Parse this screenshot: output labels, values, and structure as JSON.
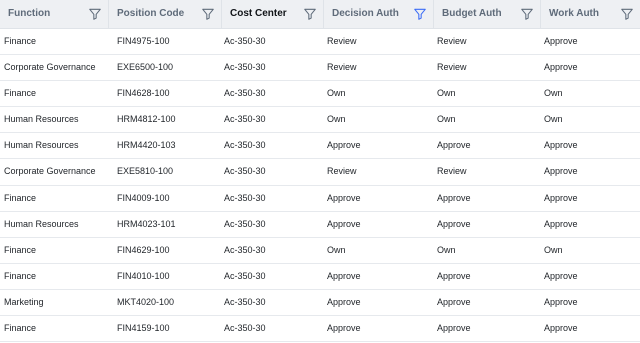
{
  "columns": [
    {
      "label": "Function",
      "filter_color": "#5f6b7a"
    },
    {
      "label": "Position Code",
      "filter_color": "#5f6b7a"
    },
    {
      "label": "Cost Center",
      "filter_color": "#5f6b7a"
    },
    {
      "label": "Decision Auth",
      "filter_color": "#3b6cf6"
    },
    {
      "label": "Budget Auth",
      "filter_color": "#5f6b7a"
    },
    {
      "label": "Work Auth",
      "filter_color": "#5f6b7a"
    }
  ],
  "rows": [
    [
      "Finance",
      "FIN4975-100",
      "Ac-350-30",
      "Review",
      "Review",
      "Approve"
    ],
    [
      "Corporate Governance",
      "EXE6500-100",
      "Ac-350-30",
      "Review",
      "Review",
      "Approve"
    ],
    [
      "Finance",
      "FIN4628-100",
      "Ac-350-30",
      "Own",
      "Own",
      "Own"
    ],
    [
      "Human Resources",
      "HRM4812-100",
      "Ac-350-30",
      "Own",
      "Own",
      "Own"
    ],
    [
      "Human Resources",
      "HRM4420-103",
      "Ac-350-30",
      "Approve",
      "Approve",
      "Approve"
    ],
    [
      "Corporate Governance",
      "EXE5810-100",
      "Ac-350-30",
      "Review",
      "Review",
      "Approve"
    ],
    [
      "Finance",
      "FIN4009-100",
      "Ac-350-30",
      "Approve",
      "Approve",
      "Approve"
    ],
    [
      "Human Resources",
      "HRM4023-101",
      "Ac-350-30",
      "Approve",
      "Approve",
      "Approve"
    ],
    [
      "Finance",
      "FIN4629-100",
      "Ac-350-30",
      "Own",
      "Own",
      "Own"
    ],
    [
      "Finance",
      "FIN4010-100",
      "Ac-350-30",
      "Approve",
      "Approve",
      "Approve"
    ],
    [
      "Marketing",
      "MKT4020-100",
      "Ac-350-30",
      "Approve",
      "Approve",
      "Approve"
    ],
    [
      "Finance",
      "FIN4159-100",
      "Ac-350-30",
      "Approve",
      "Approve",
      "Approve"
    ]
  ]
}
